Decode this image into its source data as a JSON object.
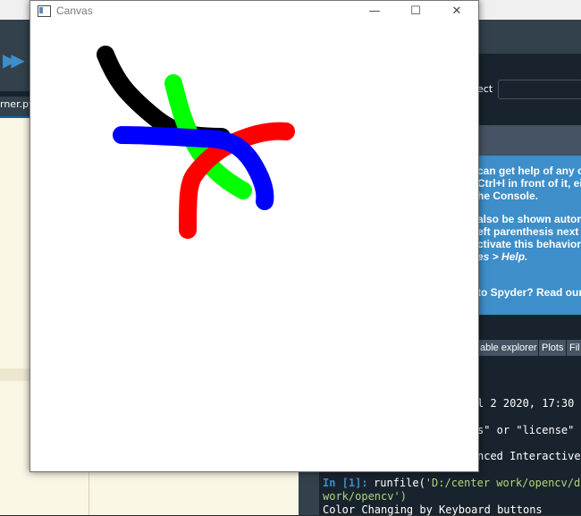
{
  "canvas_window": {
    "title": "Canvas",
    "strokes": [
      {
        "color": "#000000",
        "name": "black"
      },
      {
        "color": "#00ff00",
        "name": "green"
      },
      {
        "color": "#ff0000",
        "name": "red"
      },
      {
        "color": "#0000ff",
        "name": "blue"
      }
    ]
  },
  "ide": {
    "editor_tab": "rner.py",
    "object_label": "ect",
    "help_lines": [
      "can get help of any ob",
      "Ctrl+I in front of it, eithe",
      "he Console.",
      "",
      "also be shown automa",
      "eft parenthesis next to",
      "ctivate this behavior in",
      "es > Help.",
      "",
      "to Spyder? Read our"
    ],
    "pane_tabs": [
      "able explorer",
      "Plots",
      "Fil"
    ],
    "console_lines": [
      "l  2 2020, 17:30",
      "s\" or \"license\" f",
      "nced Interactive"
    ],
    "console_prompt": "In [1]:",
    "console_cmd": "runfile(",
    "console_path_1": "'D:/center work/opencv/dra",
    "console_path_2": "work/opencv')",
    "console_output": "Color Changing by Keyboard buttons"
  }
}
